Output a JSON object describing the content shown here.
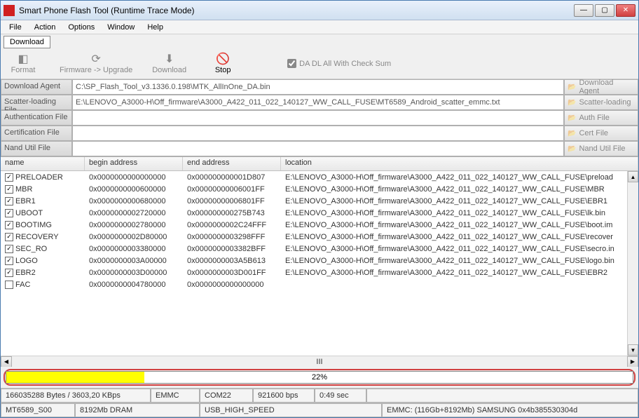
{
  "window": {
    "title": "Smart Phone Flash Tool (Runtime Trace Mode)",
    "icon_letter": ""
  },
  "menu": [
    "File",
    "Action",
    "Options",
    "Window",
    "Help"
  ],
  "tab": "Download",
  "toolbar": {
    "format": "Format",
    "upgrade": "Firmware -> Upgrade",
    "download": "Download",
    "stop": "Stop",
    "checksum": "DA DL All With Check Sum"
  },
  "fields": {
    "download_agent": {
      "label": "Download Agent",
      "value": "C:\\SP_Flash_Tool_v3.1336.0.198\\MTK_AllInOne_DA.bin",
      "btn": "Download Agent"
    },
    "scatter": {
      "label": "Scatter-loading File",
      "value": "E:\\LENOVO_A3000-H\\Off_firmware\\A3000_A422_011_022_140127_WW_CALL_FUSE\\MT6589_Android_scatter_emmc.txt",
      "btn": "Scatter-loading"
    },
    "auth": {
      "label": "Authentication File",
      "value": "",
      "btn": "Auth File"
    },
    "cert": {
      "label": "Certification File",
      "value": "",
      "btn": "Cert File"
    },
    "nand": {
      "label": "Nand Util File",
      "value": "",
      "btn": "Nand Util File"
    }
  },
  "table": {
    "headers": {
      "name": "name",
      "begin": "begin address",
      "end": "end address",
      "location": "location"
    },
    "rows": [
      {
        "checked": true,
        "name": "PRELOADER",
        "begin": "0x0000000000000000",
        "end": "0x000000000001D807",
        "location": "E:\\LENOVO_A3000-H\\Off_firmware\\A3000_A422_011_022_140127_WW_CALL_FUSE\\preload"
      },
      {
        "checked": true,
        "name": "MBR",
        "begin": "0x0000000000600000",
        "end": "0x00000000006001FF",
        "location": "E:\\LENOVO_A3000-H\\Off_firmware\\A3000_A422_011_022_140127_WW_CALL_FUSE\\MBR"
      },
      {
        "checked": true,
        "name": "EBR1",
        "begin": "0x0000000000680000",
        "end": "0x00000000006801FF",
        "location": "E:\\LENOVO_A3000-H\\Off_firmware\\A3000_A422_011_022_140127_WW_CALL_FUSE\\EBR1"
      },
      {
        "checked": true,
        "name": "UBOOT",
        "begin": "0x0000000002720000",
        "end": "0x000000000275B743",
        "location": "E:\\LENOVO_A3000-H\\Off_firmware\\A3000_A422_011_022_140127_WW_CALL_FUSE\\lk.bin"
      },
      {
        "checked": true,
        "name": "BOOTIMG",
        "begin": "0x0000000002780000",
        "end": "0x0000000002C24FFF",
        "location": "E:\\LENOVO_A3000-H\\Off_firmware\\A3000_A422_011_022_140127_WW_CALL_FUSE\\boot.im"
      },
      {
        "checked": true,
        "name": "RECOVERY",
        "begin": "0x0000000002D80000",
        "end": "0x0000000003298FFF",
        "location": "E:\\LENOVO_A3000-H\\Off_firmware\\A3000_A422_011_022_140127_WW_CALL_FUSE\\recover"
      },
      {
        "checked": true,
        "name": "SEC_RO",
        "begin": "0x0000000003380000",
        "end": "0x0000000003382BFF",
        "location": "E:\\LENOVO_A3000-H\\Off_firmware\\A3000_A422_011_022_140127_WW_CALL_FUSE\\secro.in"
      },
      {
        "checked": true,
        "name": "LOGO",
        "begin": "0x0000000003A00000",
        "end": "0x0000000003A5B613",
        "location": "E:\\LENOVO_A3000-H\\Off_firmware\\A3000_A422_011_022_140127_WW_CALL_FUSE\\logo.bin"
      },
      {
        "checked": true,
        "name": "EBR2",
        "begin": "0x0000000003D00000",
        "end": "0x0000000003D001FF",
        "location": "E:\\LENOVO_A3000-H\\Off_firmware\\A3000_A422_011_022_140127_WW_CALL_FUSE\\EBR2"
      },
      {
        "checked": false,
        "name": "FAC",
        "begin": "0x0000000004780000",
        "end": "0x0000000000000000",
        "location": ""
      }
    ],
    "hscroll_mark": "III"
  },
  "progress": {
    "percent": 22,
    "text": "22%"
  },
  "status1": [
    "166035288 Bytes / 3603,20 KBps",
    "EMMC",
    "COM22",
    "921600 bps",
    "0:49 sec",
    ""
  ],
  "status2": [
    "MT6589_S00",
    "8192Mb DRAM",
    "USB_HIGH_SPEED",
    "EMMC: (116Gb+8192Mb) SAMSUNG 0x4b385530304d"
  ]
}
